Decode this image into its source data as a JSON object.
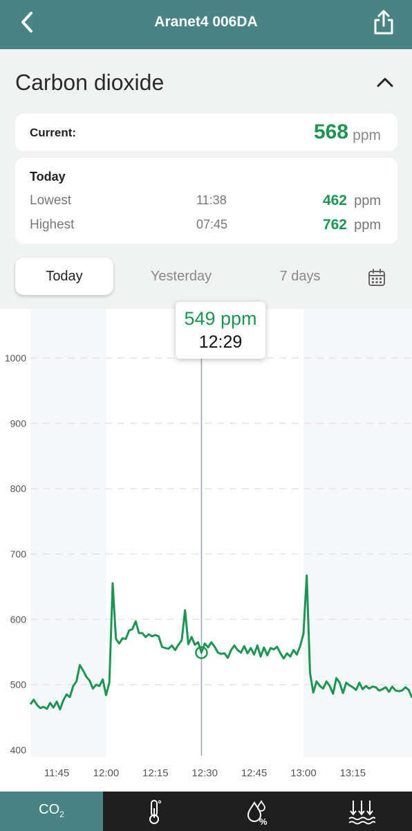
{
  "header": {
    "title": "Aranet4 006DA",
    "back_icon": "chevron-left-icon",
    "share_icon": "share-icon"
  },
  "section": {
    "title": "Carbon dioxide",
    "collapse_icon": "chevron-up-icon"
  },
  "current": {
    "label": "Current:",
    "value": "568",
    "unit": "ppm"
  },
  "today": {
    "header": "Today",
    "rows": [
      {
        "label": "Lowest",
        "time": "11:38",
        "value": "462",
        "unit": "ppm"
      },
      {
        "label": "Highest",
        "time": "07:45",
        "value": "762",
        "unit": "ppm"
      }
    ]
  },
  "tabs": {
    "items": [
      "Today",
      "Yesterday",
      "7 days"
    ],
    "active": "Today",
    "calendar_icon": "calendar-icon"
  },
  "tooltip": {
    "value": "549 ppm",
    "time": "12:29"
  },
  "bottom_nav": {
    "items": [
      {
        "label": "CO",
        "sub": "2",
        "icon": "co2-icon",
        "active": true
      },
      {
        "icon": "thermometer-icon"
      },
      {
        "icon": "humidity-icon"
      },
      {
        "icon": "pressure-icon"
      }
    ]
  },
  "colors": {
    "accent": "#4a8383",
    "value_green": "#1d9552",
    "line_green": "#1d9552"
  },
  "chart_data": {
    "type": "line",
    "y_ticks": [
      "400",
      "500",
      "600",
      "700",
      "800",
      "900",
      "1000"
    ],
    "ylim": [
      400,
      1000
    ],
    "x_ticks": [
      "11:45",
      "12:00",
      "12:15",
      "12:30",
      "12:45",
      "13:00",
      "13:15"
    ],
    "x_tick_minutes": [
      705,
      720,
      735,
      750,
      765,
      780,
      795
    ],
    "xlim": [
      "11:37",
      "13:33"
    ],
    "cursor_time": "12:29",
    "cursor_value": 549,
    "series": [
      {
        "points": [
          [
            "11:37",
            470
          ],
          [
            "11:38",
            477
          ],
          [
            "11:39",
            469
          ],
          [
            "11:40",
            464
          ],
          [
            "11:41",
            466
          ],
          [
            "11:42",
            463
          ],
          [
            "11:43",
            472
          ],
          [
            "11:44",
            465
          ],
          [
            "11:45",
            474
          ],
          [
            "11:46",
            462
          ],
          [
            "11:47",
            476
          ],
          [
            "11:48",
            485
          ],
          [
            "11:49",
            481
          ],
          [
            "11:50",
            498
          ],
          [
            "11:51",
            505
          ],
          [
            "11:52",
            530
          ],
          [
            "11:53",
            522
          ],
          [
            "11:54",
            512
          ],
          [
            "11:55",
            506
          ],
          [
            "11:56",
            494
          ],
          [
            "11:57",
            500
          ],
          [
            "11:58",
            498
          ],
          [
            "11:59",
            508
          ],
          [
            "12:00",
            484
          ],
          [
            "12:01",
            503
          ],
          [
            "12:02",
            655
          ],
          [
            "12:03",
            570
          ],
          [
            "12:04",
            563
          ],
          [
            "12:05",
            571
          ],
          [
            "12:06",
            570
          ],
          [
            "12:07",
            583
          ],
          [
            "12:08",
            585
          ],
          [
            "12:09",
            597
          ],
          [
            "12:10",
            579
          ],
          [
            "12:11",
            579
          ],
          [
            "12:12",
            573
          ],
          [
            "12:13",
            577
          ],
          [
            "12:14",
            574
          ],
          [
            "12:15",
            576
          ],
          [
            "12:16",
            574
          ],
          [
            "12:17",
            558
          ],
          [
            "12:18",
            556
          ],
          [
            "12:19",
            555
          ],
          [
            "12:20",
            560
          ],
          [
            "12:21",
            553
          ],
          [
            "12:22",
            561
          ],
          [
            "12:23",
            568
          ],
          [
            "12:24",
            614
          ],
          [
            "12:25",
            562
          ],
          [
            "12:26",
            573
          ],
          [
            "12:27",
            561
          ],
          [
            "12:28",
            565
          ],
          [
            "12:29",
            549
          ],
          [
            "12:30",
            563
          ],
          [
            "12:31",
            557
          ],
          [
            "12:32",
            565
          ],
          [
            "12:33",
            558
          ],
          [
            "12:34",
            549
          ],
          [
            "12:35",
            547
          ],
          [
            "12:36",
            548
          ],
          [
            "12:37",
            541
          ],
          [
            "12:38",
            553
          ],
          [
            "12:39",
            560
          ],
          [
            "12:40",
            553
          ],
          [
            "12:41",
            549
          ],
          [
            "12:42",
            559
          ],
          [
            "12:43",
            548
          ],
          [
            "12:44",
            556
          ],
          [
            "12:45",
            546
          ],
          [
            "12:46",
            560
          ],
          [
            "12:47",
            543
          ],
          [
            "12:48",
            557
          ],
          [
            "12:49",
            545
          ],
          [
            "12:50",
            556
          ],
          [
            "12:51",
            554
          ],
          [
            "12:52",
            558
          ],
          [
            "12:53",
            548
          ],
          [
            "12:54",
            540
          ],
          [
            "12:55",
            548
          ],
          [
            "12:56",
            543
          ],
          [
            "12:57",
            553
          ],
          [
            "12:58",
            546
          ],
          [
            "12:59",
            559
          ],
          [
            "13:00",
            578
          ],
          [
            "13:01",
            667
          ],
          [
            "13:02",
            518
          ],
          [
            "13:03",
            488
          ],
          [
            "13:04",
            505
          ],
          [
            "13:05",
            498
          ],
          [
            "13:06",
            494
          ],
          [
            "13:07",
            505
          ],
          [
            "13:08",
            498
          ],
          [
            "13:09",
            486
          ],
          [
            "13:10",
            510
          ],
          [
            "13:11",
            503
          ],
          [
            "13:12",
            487
          ],
          [
            "13:13",
            503
          ],
          [
            "13:14",
            499
          ],
          [
            "13:15",
            496
          ],
          [
            "13:16",
            492
          ],
          [
            "13:17",
            503
          ],
          [
            "13:18",
            493
          ],
          [
            "13:19",
            498
          ],
          [
            "13:20",
            494
          ],
          [
            "13:21",
            497
          ],
          [
            "13:22",
            496
          ],
          [
            "13:23",
            491
          ],
          [
            "13:24",
            493
          ],
          [
            "13:25",
            496
          ],
          [
            "13:26",
            489
          ],
          [
            "13:27",
            497
          ],
          [
            "13:28",
            491
          ],
          [
            "13:29",
            490
          ],
          [
            "13:30",
            491
          ],
          [
            "13:31",
            496
          ],
          [
            "13:32",
            492
          ],
          [
            "13:33",
            480
          ]
        ]
      }
    ]
  }
}
